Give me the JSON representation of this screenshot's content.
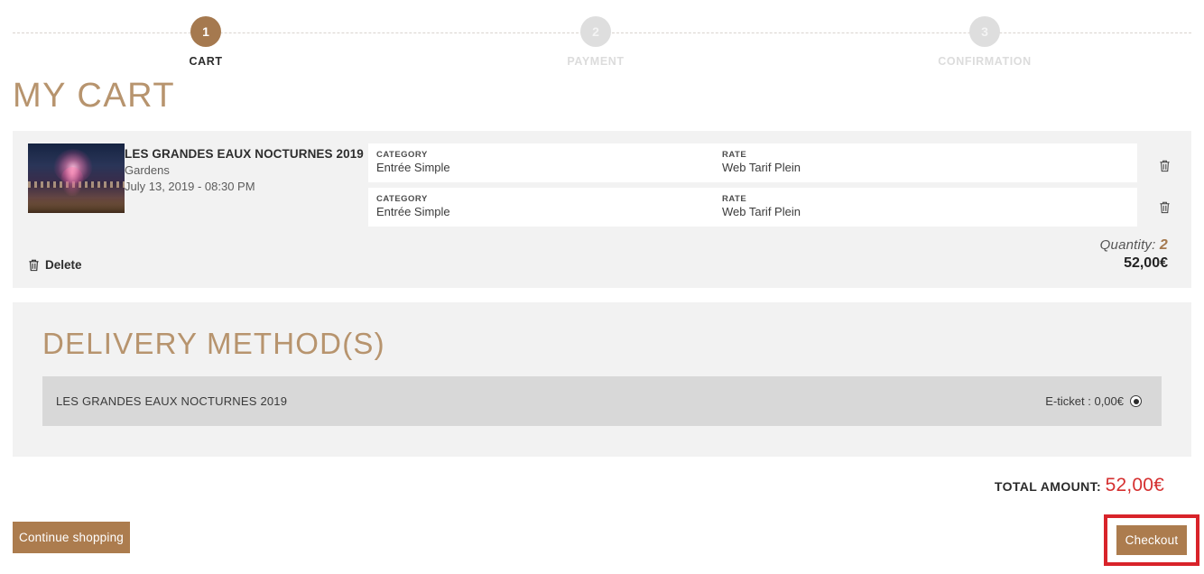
{
  "stepper": {
    "steps": [
      {
        "number": "1",
        "label": "CART",
        "state": "active"
      },
      {
        "number": "2",
        "label": "PAYMENT",
        "state": "inactive"
      },
      {
        "number": "3",
        "label": "CONFIRMATION",
        "state": "inactive"
      }
    ]
  },
  "page": {
    "title": "MY CART"
  },
  "cart": {
    "product": {
      "title": "LES GRANDES EAUX NOCTURNES 2019",
      "location": "Gardens",
      "datetime": "July 13, 2019 - 08:30 PM",
      "thumbnail_alt": "fireworks-over-gardens-photo"
    },
    "column_labels": {
      "category": "CATEGORY",
      "rate": "RATE"
    },
    "lines": [
      {
        "category": "Entrée Simple",
        "rate": "Web Tarif Plein",
        "remove_icon": "trash-icon"
      },
      {
        "category": "Entrée Simple",
        "rate": "Web Tarif Plein",
        "remove_icon": "trash-icon"
      }
    ],
    "delete_label": "Delete",
    "delete_icon": "trash-icon",
    "quantity_label": "Quantity:",
    "quantity_value": "2",
    "subtotal": "52,00€"
  },
  "delivery": {
    "title": "DELIVERY METHOD(S)",
    "rows": [
      {
        "name": "LES GRANDES EAUX NOCTURNES 2019",
        "option_label": "E-ticket : 0,00€",
        "selected": true
      }
    ]
  },
  "total": {
    "label": "TOTAL AMOUNT:",
    "value": "52,00€"
  },
  "footer": {
    "continue_label": "Continue shopping",
    "checkout_label": "Checkout"
  },
  "colors": {
    "brand_brown": "#a5794f",
    "button_brown": "#ac7c4e",
    "title_tan": "#b7946e",
    "total_red": "#d53030",
    "highlight_red": "#d8232a",
    "card_grey": "#f2f2f2",
    "row_grey": "#d8d8d8"
  }
}
